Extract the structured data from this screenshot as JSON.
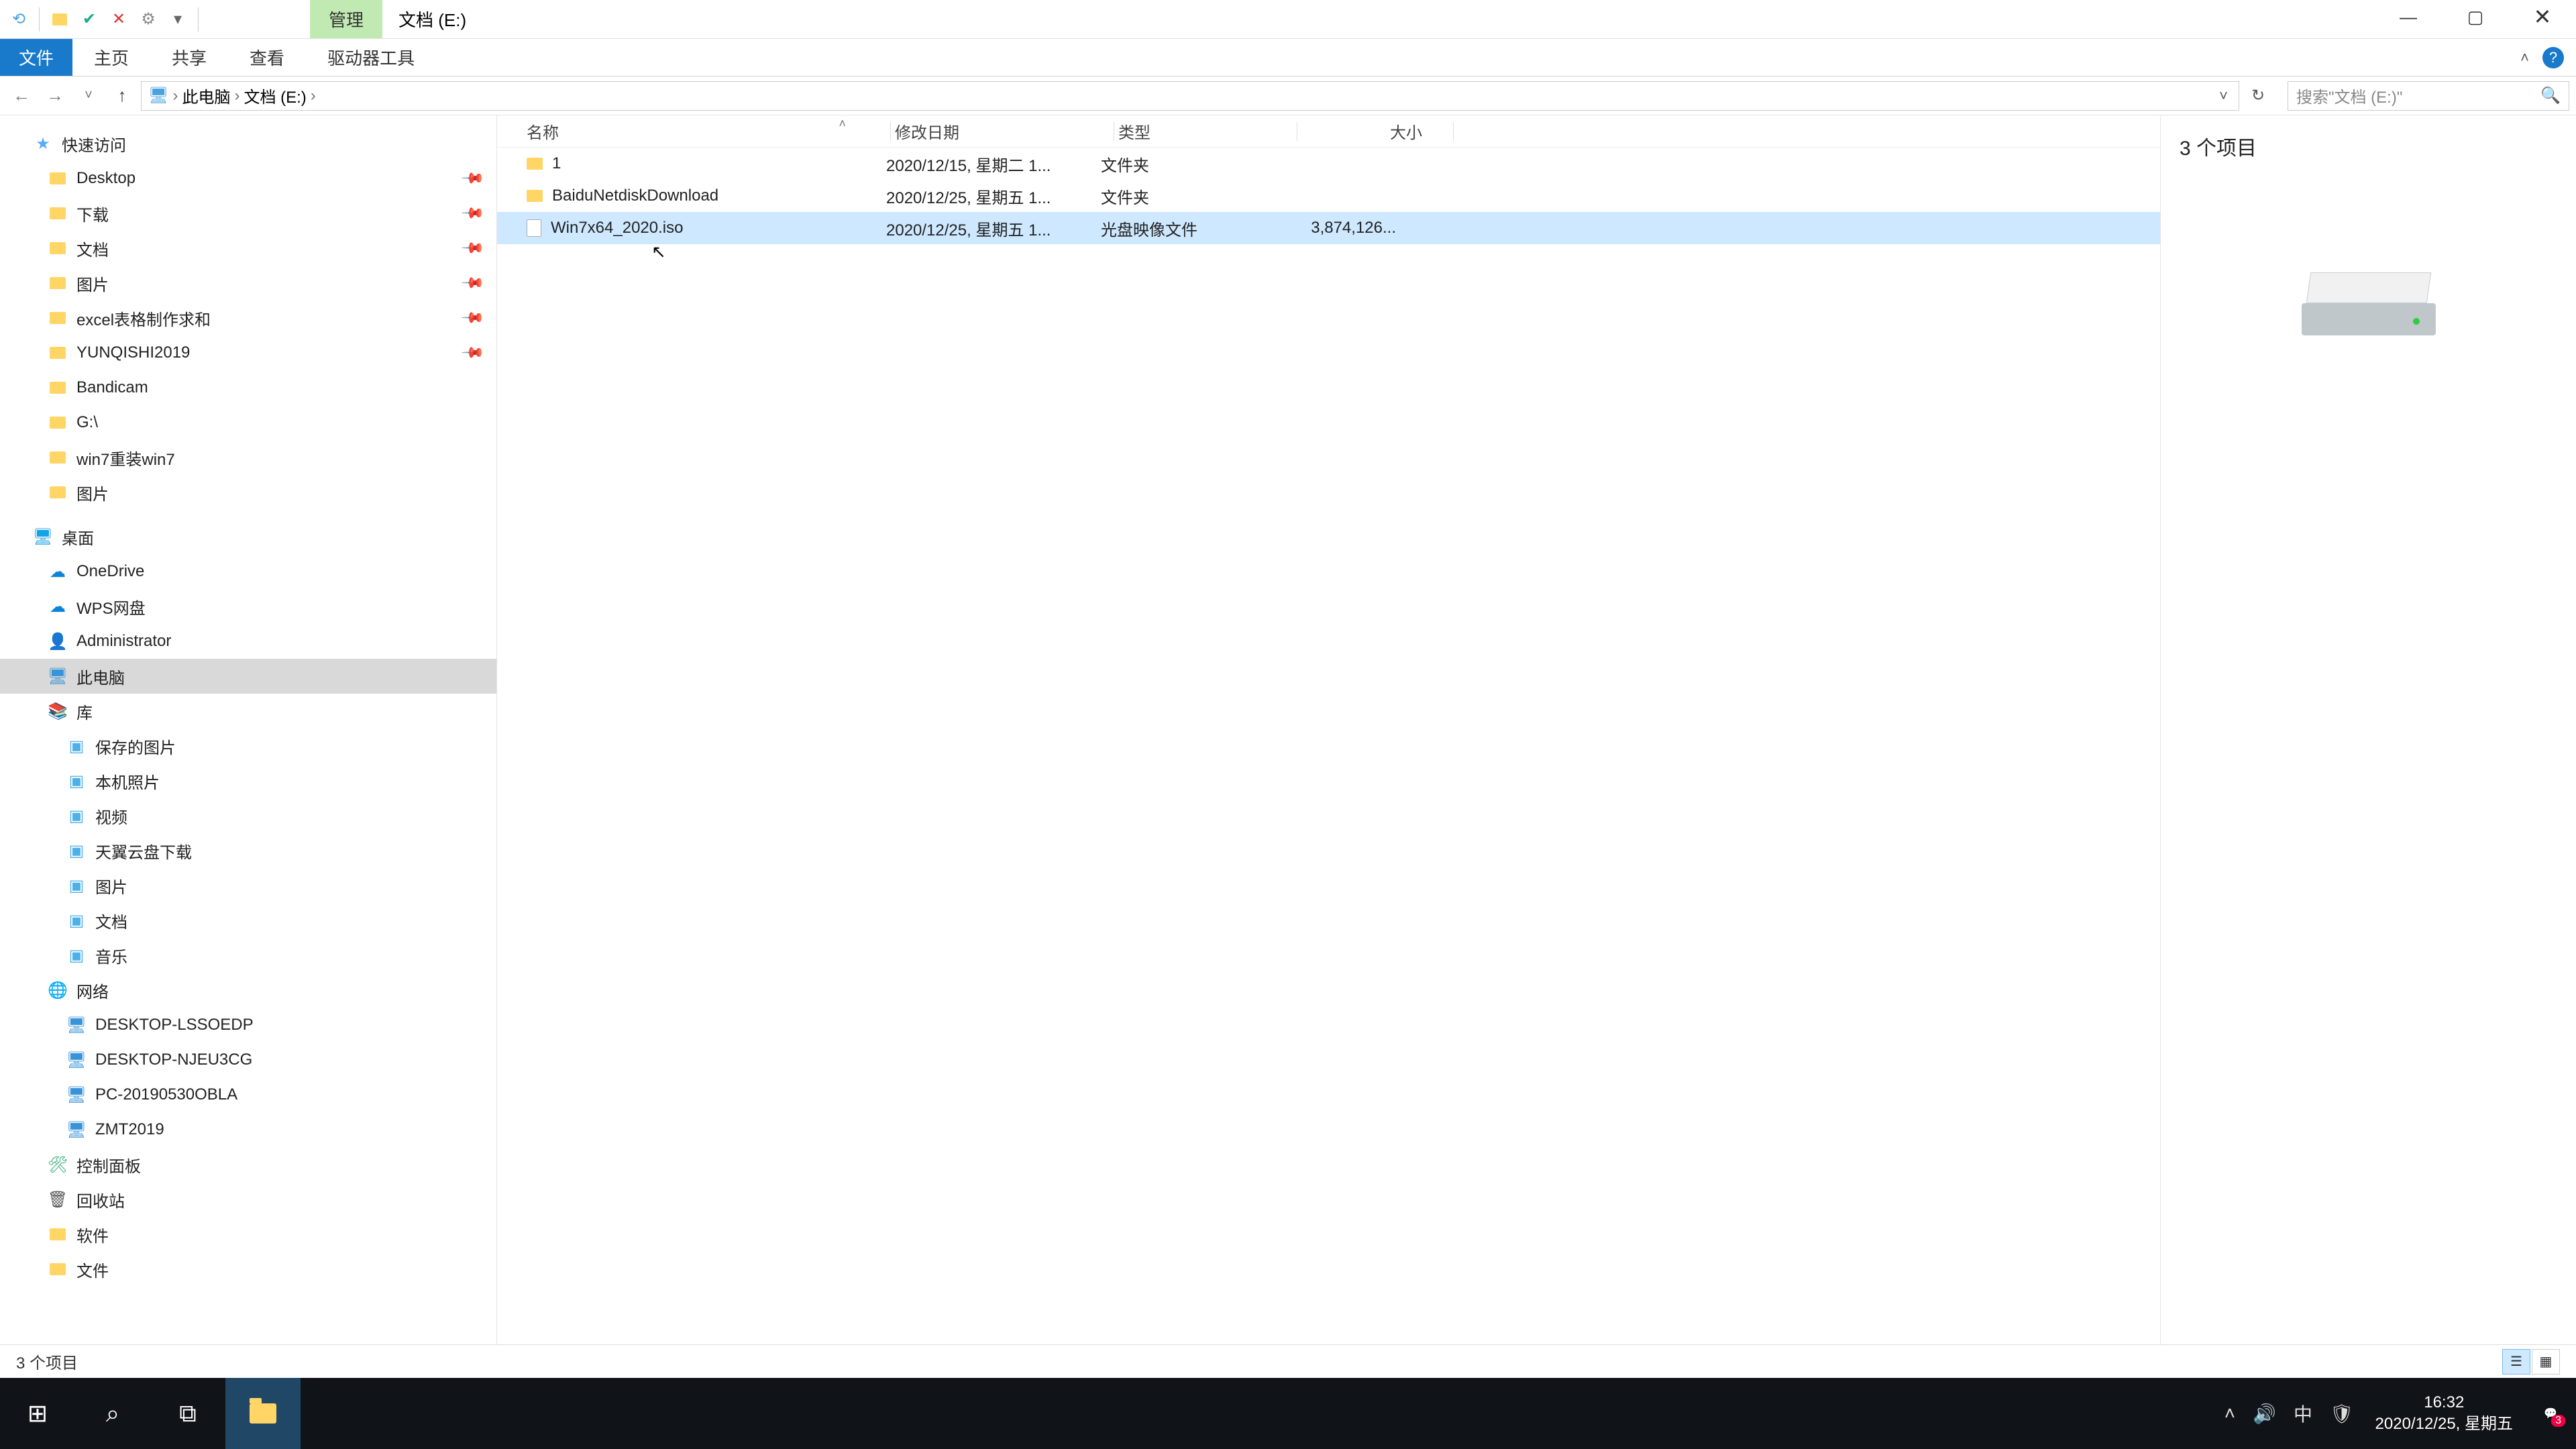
{
  "titlebar": {
    "manage_tab": "管理",
    "location_tab": "文档 (E:)"
  },
  "ribbon": {
    "file": "文件",
    "home": "主页",
    "share": "共享",
    "view": "查看",
    "drive_tools": "驱动器工具"
  },
  "address": {
    "crumbs": [
      "此电脑",
      "文档 (E:)"
    ],
    "search_placeholder": "搜索\"文档 (E:)\""
  },
  "nav": {
    "quick_access": "快速访问",
    "quick": [
      {
        "label": "Desktop",
        "pinned": true
      },
      {
        "label": "下载",
        "pinned": true
      },
      {
        "label": "文档",
        "pinned": true
      },
      {
        "label": "图片",
        "pinned": true
      },
      {
        "label": "excel表格制作求和",
        "pinned": true
      },
      {
        "label": "YUNQISHI2019",
        "pinned": true
      },
      {
        "label": "Bandicam"
      },
      {
        "label": "G:\\"
      },
      {
        "label": "win7重装win7"
      },
      {
        "label": "图片"
      }
    ],
    "desktop_group": "桌面",
    "onedrive": "OneDrive",
    "wps": "WPS网盘",
    "admin": "Administrator",
    "this_pc": "此电脑",
    "libraries": "库",
    "lib_items": [
      "保存的图片",
      "本机照片",
      "视频",
      "天翼云盘下载",
      "图片",
      "文档",
      "音乐"
    ],
    "network": "网络",
    "net_items": [
      "DESKTOP-LSSOEDP",
      "DESKTOP-NJEU3CG",
      "PC-20190530OBLA",
      "ZMT2019"
    ],
    "control_panel": "控制面板",
    "recycle": "回收站",
    "software": "软件",
    "docs": "文件"
  },
  "columns": {
    "name": "名称",
    "date": "修改日期",
    "type": "类型",
    "size": "大小"
  },
  "files": [
    {
      "name": "1",
      "date": "2020/12/15, 星期二 1...",
      "type": "文件夹",
      "size": "",
      "icon": "folder"
    },
    {
      "name": "BaiduNetdiskDownload",
      "date": "2020/12/25, 星期五 1...",
      "type": "文件夹",
      "size": "",
      "icon": "folder"
    },
    {
      "name": "Win7x64_2020.iso",
      "date": "2020/12/25, 星期五 1...",
      "type": "光盘映像文件",
      "size": "3,874,126...",
      "icon": "iso",
      "selected": true
    }
  ],
  "preview": {
    "title": "3 个项目"
  },
  "status": {
    "text": "3 个项目"
  },
  "tray": {
    "ime": "中",
    "time": "16:32",
    "date": "2020/12/25, 星期五",
    "notif_count": "3"
  }
}
